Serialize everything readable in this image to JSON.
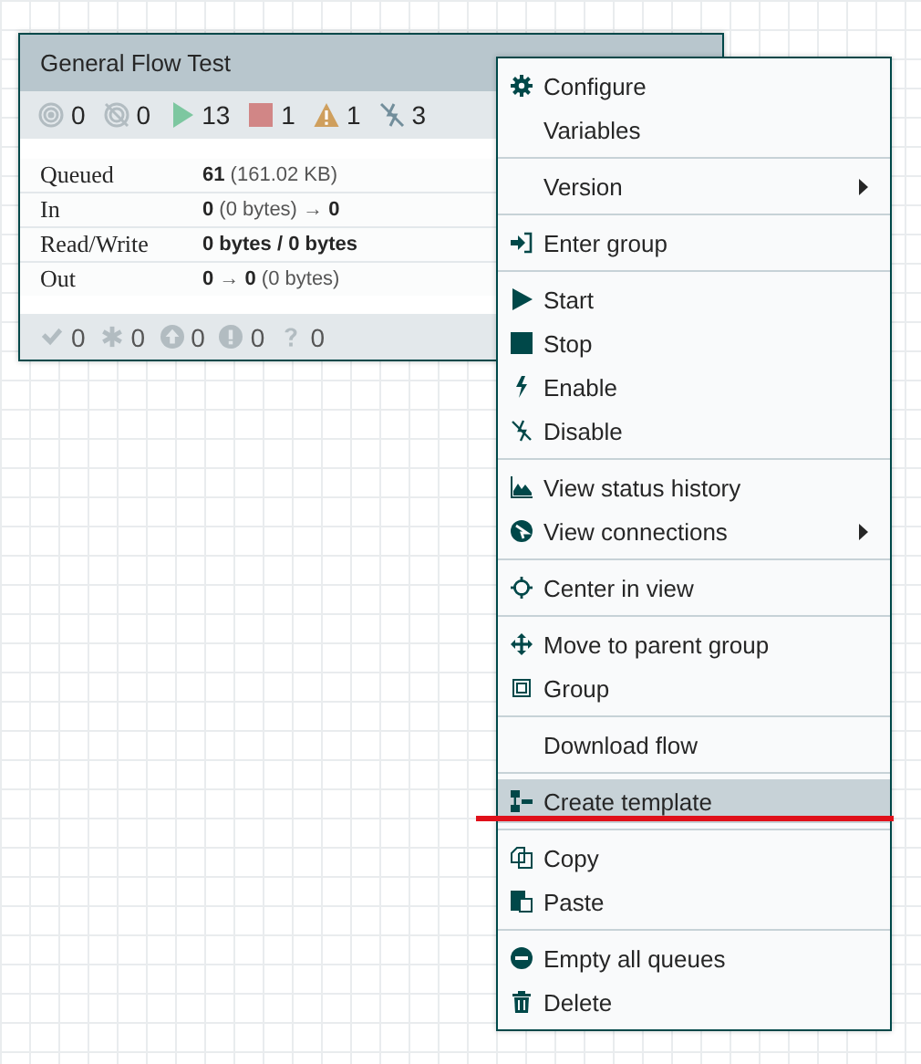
{
  "process_group": {
    "title": "General Flow Test",
    "stats": [
      {
        "kind": "transmitting",
        "count": "0"
      },
      {
        "kind": "not-transmitting",
        "count": "0"
      },
      {
        "kind": "running",
        "count": "13"
      },
      {
        "kind": "stopped",
        "count": "1"
      },
      {
        "kind": "invalid",
        "count": "1"
      },
      {
        "kind": "disabled",
        "count": "3"
      }
    ],
    "metrics": [
      {
        "label": "Queued",
        "value": "**61** (161.02 KB)"
      },
      {
        "label": "In",
        "value": "**0** (0 bytes) → **0**"
      },
      {
        "label": "Read/Write",
        "value": "**0 bytes / 0 bytes**"
      },
      {
        "label": "Out",
        "value": "**0** → **0** (0 bytes)"
      }
    ],
    "versions": [
      {
        "kind": "up-to-date",
        "count": "0"
      },
      {
        "kind": "modified",
        "count": "0"
      },
      {
        "kind": "stale",
        "count": "0"
      },
      {
        "kind": "modified-stale",
        "count": "0"
      },
      {
        "kind": "sync-failure",
        "count": "0"
      }
    ]
  },
  "context_menu": {
    "sections": [
      {
        "items": [
          {
            "label": "Configure",
            "submenu": false,
            "selected": false
          },
          {
            "label": "Variables",
            "submenu": false,
            "selected": false
          }
        ]
      },
      {
        "items": [
          {
            "label": "Version",
            "submenu": true,
            "selected": false
          }
        ]
      },
      {
        "items": [
          {
            "label": "Enter group",
            "submenu": false,
            "selected": false
          }
        ]
      },
      {
        "items": [
          {
            "label": "Start",
            "submenu": false,
            "selected": false
          },
          {
            "label": "Stop",
            "submenu": false,
            "selected": false
          },
          {
            "label": "Enable",
            "submenu": false,
            "selected": false
          },
          {
            "label": "Disable",
            "submenu": false,
            "selected": false
          }
        ]
      },
      {
        "items": [
          {
            "label": "View status history",
            "submenu": false,
            "selected": false
          },
          {
            "label": "View connections",
            "submenu": true,
            "selected": false
          }
        ]
      },
      {
        "items": [
          {
            "label": "Center in view",
            "submenu": false,
            "selected": false
          }
        ]
      },
      {
        "items": [
          {
            "label": "Move to parent group",
            "submenu": false,
            "selected": false
          },
          {
            "label": "Group",
            "submenu": false,
            "selected": false
          }
        ]
      },
      {
        "items": [
          {
            "label": "Download flow",
            "submenu": false,
            "selected": false
          }
        ]
      },
      {
        "items": [
          {
            "label": "Create template",
            "submenu": false,
            "selected": true
          }
        ]
      },
      {
        "items": [
          {
            "label": "Copy",
            "submenu": false,
            "selected": false
          },
          {
            "label": "Paste",
            "submenu": false,
            "selected": false
          }
        ]
      },
      {
        "items": [
          {
            "label": "Empty all queues",
            "submenu": false,
            "selected": false
          },
          {
            "label": "Delete",
            "submenu": false,
            "selected": false
          }
        ]
      }
    ]
  }
}
